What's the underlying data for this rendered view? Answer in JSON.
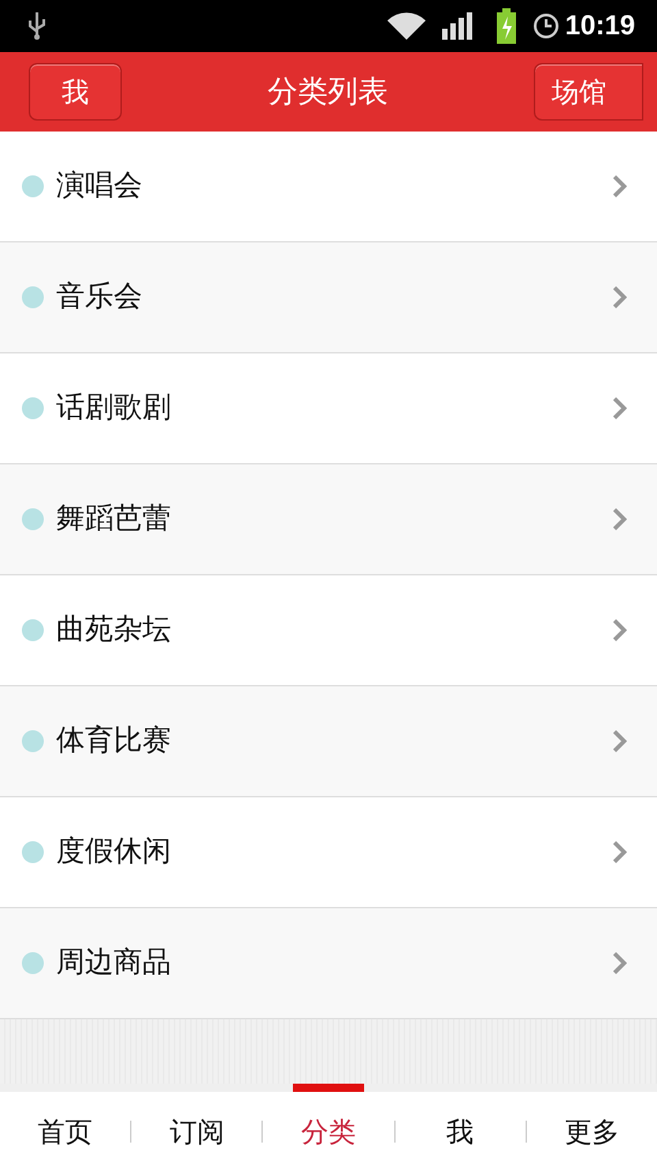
{
  "status_bar": {
    "time": "10:19"
  },
  "header": {
    "left_button": "我",
    "title": "分类列表",
    "right_button": "场馆"
  },
  "categories": [
    {
      "label": "演唱会"
    },
    {
      "label": "音乐会"
    },
    {
      "label": "话剧歌剧"
    },
    {
      "label": "舞蹈芭蕾"
    },
    {
      "label": "曲苑杂坛"
    },
    {
      "label": "体育比赛"
    },
    {
      "label": "度假休闲"
    },
    {
      "label": "周边商品"
    }
  ],
  "tabs": [
    {
      "label": "首页",
      "selected": false
    },
    {
      "label": "订阅",
      "selected": false
    },
    {
      "label": "分类",
      "selected": true
    },
    {
      "label": "我",
      "selected": false
    },
    {
      "label": "更多",
      "selected": false
    }
  ]
}
